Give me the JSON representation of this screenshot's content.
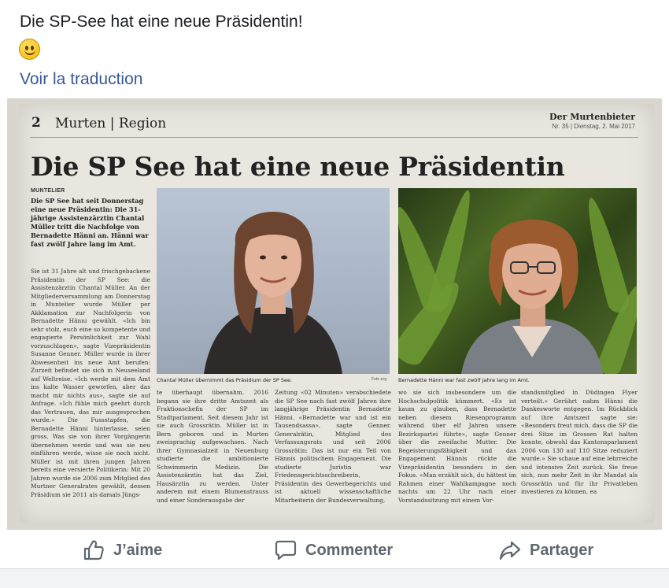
{
  "post": {
    "text": "Die SP-See hat eine neue Präsidentin!",
    "emoji": "slightly-smiling-face",
    "translate_link": "Voir la traduction"
  },
  "newspaper": {
    "page_number": "2",
    "section": "Murten | Region",
    "masthead": "Der Murtenbieter",
    "issue": "Nr. 35  |  Dienstag, 2. Mai 2017",
    "headline": "Die SP See hat eine neue Präsidentin",
    "kicker": "MUNTELIER",
    "lead": "Die SP See hat seit Donnerstag eine neue Präsidentin: Die 31-jährige Assistenzärztin Chantal Müller tritt die Nachfolge von Bernadette Hänni an. Hänni war fast zwölf Jahre lang im Amt.",
    "col1": "Sie ist 31 Jahre alt und frischgebackene Präsidentin der SP See: die Assistenzärztin Chantal Müller. An der Mitgliederversammlung am Donnerstag in Muntelier wurde Müller per Akklamation zur Nachfolgerin von Bernadette Hänni gewählt. «Ich bin sehr stolz, euch eine so kompetente und engagierte Persönlichkeit zur Wahl vorzuschlagen», sagte Vizepräsidentin Susanne Genner. Müller wurde in ihrer Abwesenheit ins neue Amt berufen: Zurzeit befindet sie sich in Neuseeland auf Weltreise. «Ich werde mit dem Amt ins kalte Wasser geworfen, aber das macht mir nichts aus», sagte sie auf Anfrage. «Ich fühle mich geehrt durch das Vertrauen, das mir ausgesprochen wurde.» Die Fussstapfen, die Bernadette Hänni hinterlasse, seien gross. Was sie von ihrer Vorgängerin übernehmen werde und was sie neu einführen werde, wisse sie noch nicht. Müller ist mit ihren jungen Jahren bereits eine versierte Politikerin: Mit 20 Jahren wurde sie 2006 zum Mitglied des Murtner Generalrates gewählt, dessen Präsidium sie 2011 als damals Jüngs-",
    "col2": "te überhaupt übernahm. 2016 begann sie ihre dritte Amtszeit als Fraktionschefin der SP im Stadtparlament. Seit diesem Jahr ist sie auch Grossrätin. Müller ist in Bern geboren und in Murten zweisprachig aufgewachsen. Nach ihrer Gymnasialzeit in Neuenburg studierte die ambitionierte Schwimmerin Medizin. Die Assistenzärztin hat das Ziel, Hausärztin zu werden. Unter anderem mit einem Blumenstrauss und einer Sonderausgabe der",
    "col3": "Zeitung «02 Minuten» verabschiedete die SP See nach fast zwölf Jahren ihre langjährige Präsidentin Bernadette Hänni. «Bernadette war und ist ein Tausendsassa», sagte Genner. Generalrätin, Mitglied des Verfassungsrats und seit 2006 Grossrätin: Das ist nur ein Teil von Hännis politischem Engagement. Die studierte Juristin war Friedensgerichtsschreiberin, Präsidentin des Gewerbegerichts und ist aktuell wissenschaftliche Mitarbeiterin der Bundesverwaltung,",
    "col4": "wo sie sich insbesondere um die Hochschulpolitik kümmert. «Es ist kaum zu glauben, dass Bernadette neben diesem Riesenprogramm während über elf Jahren unsere Bezirkspartei führte», sagte Genner über die zweifache Mutter. Die Begeisterungsfähigkeit und das Engagement Hännis rückte die Vizepräsidentin besonders in den Fokus. «Man erzählt sich, du hättest im Rahmen einer Wahlkampagne noch nachts um 22 Uhr nach einer Vorstandssitzung mit einem Vor-",
    "col5": "standsmitglied in Düdingen Flyer verteilt.» Gerührt nahm Hänni die Dankesworte entgegen. Im Rückblick auf ihre Amtszeit sagte sie: «Besonders freut mich, dass die SP die drei Sitze im Grossen Rat halten konnte, obwohl das Kantonsparlament 2006 von 130 auf 110 Sitze reduziert wurde.» Sie schaue auf eine lehrreiche und intensive Zeit zurück. Sie freue sich, nun mehr Zeit in ihr Mandat als Grossrätin und für ihr Privatleben investieren zu können.       ea",
    "caption1": "Chantal Müller übernimmt das Präsidium der SP See.",
    "credit1": "Foto zvg",
    "caption2": "Bernadette Hänni war fast zwölf Jahre lang im Amt."
  },
  "actions": {
    "like": "J’aime",
    "comment": "Commenter",
    "share": "Partager"
  },
  "colors": {
    "link": "#385898",
    "action_text": "#606770"
  }
}
